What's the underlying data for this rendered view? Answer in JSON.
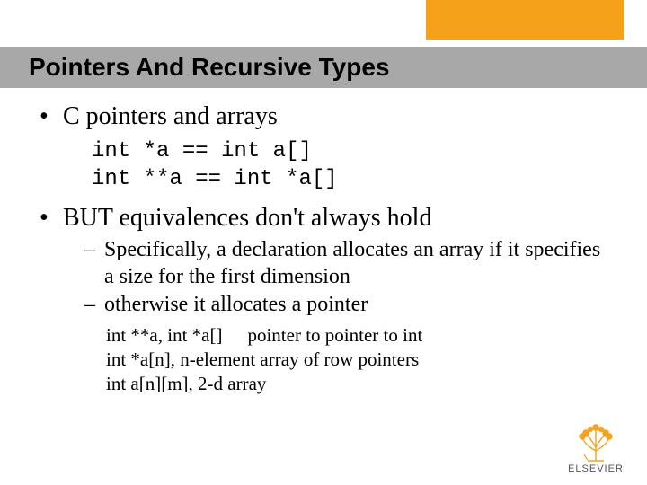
{
  "title": "Pointers And Recursive Types",
  "bullets": {
    "b1": "C pointers and arrays",
    "code_line1": "int *a == int a[]",
    "code_line2": "int **a == int *a[]",
    "b2": "BUT equivalences don't always hold",
    "b2_sub1": "Specifically, a declaration allocates an array if it specifies a size for the first dimension",
    "b2_sub2": "otherwise it allocates a pointer",
    "ex1_left": "int **a, int *a[]",
    "ex1_right": "pointer to pointer to int",
    "ex2": "int *a[n], n-element array of row pointers",
    "ex3": "int a[n][m], 2-d array"
  },
  "logo_text": "ELSEVIER"
}
